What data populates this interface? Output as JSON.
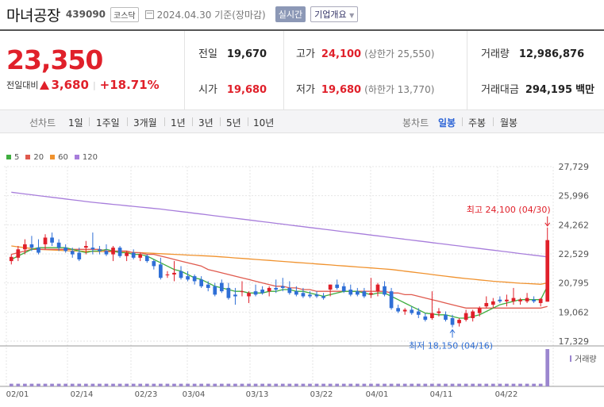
{
  "header": {
    "name": "마녀공장",
    "code": "439090",
    "market": "코스닥",
    "date_text": "2024.04.30 기준(장마감)",
    "live_button": "실시간",
    "company_button": "기업개요"
  },
  "summary": {
    "price": "23,350",
    "change_label": "전일대비",
    "change_value": "3,680",
    "change_pct": "+18.71%",
    "prev_label": "전일",
    "prev_value": "19,670",
    "high_label": "고가",
    "high_value": "24,100",
    "upper_limit": "(상한가 25,550)",
    "volume_label": "거래량",
    "volume_value": "12,986,876",
    "open_label": "시가",
    "open_value": "19,680",
    "low_label": "저가",
    "low_value": "19,680",
    "lower_limit": "(하한가 13,770)",
    "amount_label": "거래대금",
    "amount_value": "294,195",
    "amount_unit": "백만"
  },
  "periods": {
    "line_label": "선차트",
    "items": [
      "1일",
      "1주일",
      "3개월",
      "1년",
      "3년",
      "5년",
      "10년"
    ],
    "candle_label": "봉차트",
    "candle_items": [
      "일봉",
      "주봉",
      "월봉"
    ],
    "candle_active": "일봉"
  },
  "legend": [
    {
      "name": "5",
      "color": "#3fae3f"
    },
    {
      "name": "20",
      "color": "#e05a4e"
    },
    {
      "name": "60",
      "color": "#f0922e"
    },
    {
      "name": "120",
      "color": "#a77ddb"
    }
  ],
  "colors": {
    "up": "#e0202a",
    "down": "#2f6fd6",
    "volume": "#9b86cf"
  },
  "chart_data": {
    "type": "candlestick",
    "y_ticks": [
      "27,729",
      "25,996",
      "24,262",
      "22,529",
      "20,795",
      "19,062",
      "17,329"
    ],
    "ylim": [
      17329,
      27729
    ],
    "x_labels": [
      "02/01",
      "02/14",
      "02/23",
      "03/04",
      "03/13",
      "03/22",
      "04/01",
      "04/11",
      "04/22"
    ],
    "high_annotation": "최고 24,100 (04/30)",
    "low_annotation": "최저 18,150 (04/16)",
    "volume_label": "거래량",
    "candles": [
      {
        "o": 22100,
        "h": 22500,
        "l": 21900,
        "c": 22350
      },
      {
        "o": 22300,
        "h": 23000,
        "l": 22100,
        "c": 22800
      },
      {
        "o": 22800,
        "h": 23400,
        "l": 22500,
        "c": 23100
      },
      {
        "o": 23100,
        "h": 23600,
        "l": 22700,
        "c": 22900
      },
      {
        "o": 22900,
        "h": 23400,
        "l": 22500,
        "c": 22600
      },
      {
        "o": 23100,
        "h": 23700,
        "l": 22800,
        "c": 23500
      },
      {
        "o": 23500,
        "h": 23800,
        "l": 23000,
        "c": 23200
      },
      {
        "o": 23200,
        "h": 23400,
        "l": 22700,
        "c": 22900
      },
      {
        "o": 22900,
        "h": 23100,
        "l": 22600,
        "c": 22700
      },
      {
        "o": 22700,
        "h": 22900,
        "l": 22300,
        "c": 22500
      },
      {
        "o": 22600,
        "h": 22900,
        "l": 22100,
        "c": 22200
      },
      {
        "o": 22900,
        "h": 23300,
        "l": 22500,
        "c": 23000
      },
      {
        "o": 22900,
        "h": 23800,
        "l": 22500,
        "c": 22800
      },
      {
        "o": 22800,
        "h": 23000,
        "l": 22500,
        "c": 22700
      },
      {
        "o": 22700,
        "h": 23100,
        "l": 22400,
        "c": 22500
      },
      {
        "o": 22500,
        "h": 23000,
        "l": 22100,
        "c": 22900
      },
      {
        "o": 22900,
        "h": 23000,
        "l": 22300,
        "c": 22400
      },
      {
        "o": 22400,
        "h": 22700,
        "l": 22100,
        "c": 22600
      },
      {
        "o": 22600,
        "h": 22800,
        "l": 22200,
        "c": 22300
      },
      {
        "o": 22300,
        "h": 22600,
        "l": 22100,
        "c": 22500
      },
      {
        "o": 22400,
        "h": 22500,
        "l": 22000,
        "c": 22100
      },
      {
        "o": 22100,
        "h": 22200,
        "l": 21600,
        "c": 21800
      },
      {
        "o": 21900,
        "h": 22300,
        "l": 21000,
        "c": 21100
      },
      {
        "o": 21300,
        "h": 21500,
        "l": 21100,
        "c": 21300
      },
      {
        "o": 21300,
        "h": 22100,
        "l": 20900,
        "c": 21400
      },
      {
        "o": 21500,
        "h": 21800,
        "l": 21000,
        "c": 21100
      },
      {
        "o": 21200,
        "h": 21500,
        "l": 20900,
        "c": 21000
      },
      {
        "o": 21200,
        "h": 21300,
        "l": 20700,
        "c": 20900
      },
      {
        "o": 21000,
        "h": 21200,
        "l": 20500,
        "c": 20600
      },
      {
        "o": 20700,
        "h": 20900,
        "l": 20300,
        "c": 20500
      },
      {
        "o": 20600,
        "h": 20800,
        "l": 20000,
        "c": 20100
      },
      {
        "o": 20800,
        "h": 21000,
        "l": 20200,
        "c": 20300
      },
      {
        "o": 20500,
        "h": 20800,
        "l": 19800,
        "c": 19900
      },
      {
        "o": 20100,
        "h": 20500,
        "l": 19500,
        "c": 20000
      },
      {
        "o": 20300,
        "h": 20900,
        "l": 20000,
        "c": 20300
      },
      {
        "o": 20000,
        "h": 20300,
        "l": 19600,
        "c": 20200
      },
      {
        "o": 20300,
        "h": 20700,
        "l": 20000,
        "c": 20100
      },
      {
        "o": 20400,
        "h": 20600,
        "l": 20100,
        "c": 20200
      },
      {
        "o": 20300,
        "h": 20600,
        "l": 20000,
        "c": 20500
      },
      {
        "o": 20500,
        "h": 21000,
        "l": 20200,
        "c": 20400
      },
      {
        "o": 20600,
        "h": 21100,
        "l": 20300,
        "c": 20500
      },
      {
        "o": 20500,
        "h": 20900,
        "l": 20100,
        "c": 20200
      },
      {
        "o": 20300,
        "h": 20600,
        "l": 20000,
        "c": 20100
      },
      {
        "o": 20200,
        "h": 20500,
        "l": 19900,
        "c": 20000
      },
      {
        "o": 20100,
        "h": 20300,
        "l": 19900,
        "c": 20000
      },
      {
        "o": 20100,
        "h": 20300,
        "l": 19900,
        "c": 20000
      },
      {
        "o": 20000,
        "h": 20200,
        "l": 19800,
        "c": 19900
      },
      {
        "o": 20400,
        "h": 20700,
        "l": 20000,
        "c": 20700
      },
      {
        "o": 20700,
        "h": 21000,
        "l": 20400,
        "c": 20500
      },
      {
        "o": 20600,
        "h": 20800,
        "l": 20200,
        "c": 20300
      },
      {
        "o": 20400,
        "h": 20700,
        "l": 20000,
        "c": 20100
      },
      {
        "o": 20300,
        "h": 20500,
        "l": 20000,
        "c": 20100
      },
      {
        "o": 20300,
        "h": 20500,
        "l": 19900,
        "c": 20000
      },
      {
        "o": 20100,
        "h": 21100,
        "l": 19900,
        "c": 20200
      },
      {
        "o": 20300,
        "h": 20800,
        "l": 20000,
        "c": 20700
      },
      {
        "o": 20600,
        "h": 20900,
        "l": 20000,
        "c": 20100
      },
      {
        "o": 20300,
        "h": 20500,
        "l": 19200,
        "c": 19300
      },
      {
        "o": 19300,
        "h": 19500,
        "l": 19000,
        "c": 19100
      },
      {
        "o": 19100,
        "h": 19300,
        "l": 18900,
        "c": 19200
      },
      {
        "o": 19200,
        "h": 19400,
        "l": 18900,
        "c": 19000
      },
      {
        "o": 19100,
        "h": 19300,
        "l": 18700,
        "c": 18900
      },
      {
        "o": 18800,
        "h": 19000,
        "l": 18500,
        "c": 18600
      },
      {
        "o": 18700,
        "h": 20300,
        "l": 18600,
        "c": 19000
      },
      {
        "o": 19000,
        "h": 19300,
        "l": 18800,
        "c": 19100
      },
      {
        "o": 18900,
        "h": 19100,
        "l": 18500,
        "c": 18600
      },
      {
        "o": 18700,
        "h": 18900,
        "l": 18150,
        "c": 18300
      },
      {
        "o": 18400,
        "h": 18700,
        "l": 18200,
        "c": 18600
      },
      {
        "o": 18600,
        "h": 19200,
        "l": 18500,
        "c": 19000
      },
      {
        "o": 18700,
        "h": 19200,
        "l": 18500,
        "c": 19100
      },
      {
        "o": 19000,
        "h": 19400,
        "l": 18800,
        "c": 19300
      },
      {
        "o": 19400,
        "h": 20000,
        "l": 19300,
        "c": 19600
      },
      {
        "o": 19500,
        "h": 19900,
        "l": 19300,
        "c": 19700
      },
      {
        "o": 19800,
        "h": 20000,
        "l": 19600,
        "c": 19700
      },
      {
        "o": 19700,
        "h": 20100,
        "l": 19400,
        "c": 19800
      },
      {
        "o": 19700,
        "h": 20500,
        "l": 19500,
        "c": 19900
      },
      {
        "o": 19700,
        "h": 19900,
        "l": 19500,
        "c": 19800
      },
      {
        "o": 19700,
        "h": 20200,
        "l": 19600,
        "c": 19900
      },
      {
        "o": 19800,
        "h": 20000,
        "l": 19600,
        "c": 19700
      },
      {
        "o": 19600,
        "h": 19900,
        "l": 19400,
        "c": 19850
      },
      {
        "o": 19680,
        "h": 24100,
        "l": 19680,
        "c": 23350
      }
    ],
    "ma5": [
      22200,
      22400,
      22600,
      22800,
      22900,
      22900,
      22900,
      22900,
      22900,
      22800,
      22700,
      22600,
      22700,
      22700,
      22800,
      22700,
      22600,
      22600,
      22500,
      22500,
      22400,
      22200,
      22000,
      21800,
      21600,
      21500,
      21300,
      21100,
      21000,
      20800,
      20600,
      20500,
      20400,
      20300,
      20300,
      20200,
      20200,
      20200,
      20300,
      20300,
      20400,
      20400,
      20300,
      20300,
      20200,
      20100,
      20000,
      20100,
      20200,
      20300,
      20300,
      20300,
      20200,
      20100,
      20200,
      20200,
      20000,
      19800,
      19600,
      19400,
      19200,
      19000,
      18950,
      18900,
      18900,
      18800,
      18700,
      18700,
      18800,
      18900,
      19100,
      19300,
      19500,
      19600,
      19700,
      19800,
      19800,
      19800,
      19800,
      20600
    ],
    "ma20": [
      22500,
      22600,
      22700,
      22800,
      22800,
      22800,
      22800,
      22800,
      22800,
      22800,
      22800,
      22800,
      22800,
      22800,
      22700,
      22700,
      22700,
      22700,
      22600,
      22600,
      22500,
      22500,
      22400,
      22300,
      22200,
      22100,
      22000,
      21900,
      21800,
      21600,
      21500,
      21400,
      21300,
      21200,
      21100,
      21000,
      20900,
      20800,
      20700,
      20600,
      20600,
      20500,
      20500,
      20400,
      20400,
      20300,
      20300,
      20300,
      20300,
      20300,
      20300,
      20300,
      20300,
      20300,
      20300,
      20300,
      20200,
      20200,
      20100,
      20100,
      20000,
      19900,
      19800,
      19700,
      19600,
      19500,
      19400,
      19300,
      19300,
      19300,
      19300,
      19300,
      19300,
      19300,
      19300,
      19300,
      19300,
      19300,
      19300,
      19400
    ],
    "ma60": [
      23000,
      22950,
      22900,
      22850,
      22800,
      22780,
      22760,
      22740,
      22720,
      22700,
      22700,
      22690,
      22680,
      22670,
      22660,
      22650,
      22640,
      22630,
      22620,
      22600,
      22580,
      22560,
      22540,
      22520,
      22500,
      22480,
      22460,
      22440,
      22420,
      22400,
      22380,
      22350,
      22320,
      22290,
      22260,
      22230,
      22200,
      22170,
      22140,
      22110,
      22080,
      22050,
      22020,
      21990,
      21960,
      21930,
      21900,
      21870,
      21840,
      21810,
      21780,
      21750,
      21720,
      21690,
      21660,
      21630,
      21600,
      21550,
      21500,
      21450,
      21400,
      21350,
      21300,
      21250,
      21200,
      21150,
      21100,
      21060,
      21020,
      20980,
      20940,
      20900,
      20870,
      20840,
      20810,
      20780,
      20760,
      20740,
      20720,
      20800
    ],
    "ma120": [
      26200,
      26150,
      26100,
      26050,
      26000,
      25950,
      25900,
      25850,
      25800,
      25750,
      25700,
      25650,
      25600,
      25560,
      25520,
      25480,
      25440,
      25400,
      25360,
      25320,
      25280,
      25240,
      25200,
      25150,
      25100,
      25050,
      25000,
      24950,
      24900,
      24850,
      24800,
      24750,
      24700,
      24650,
      24600,
      24550,
      24500,
      24450,
      24400,
      24350,
      24300,
      24250,
      24200,
      24150,
      24100,
      24050,
      24000,
      23950,
      23900,
      23850,
      23800,
      23750,
      23700,
      23650,
      23600,
      23550,
      23500,
      23450,
      23400,
      23350,
      23300,
      23250,
      23200,
      23150,
      23100,
      23050,
      23000,
      22950,
      22900,
      22850,
      22800,
      22750,
      22700,
      22650,
      22600,
      22550,
      22500,
      22450,
      22400,
      22350
    ],
    "volume": [
      1,
      1,
      1,
      1,
      1,
      1,
      1,
      1,
      1,
      1,
      1,
      1,
      1,
      1,
      1,
      1,
      1,
      1,
      1,
      1,
      1,
      1,
      1,
      1,
      1,
      1,
      1,
      1,
      1,
      1,
      1,
      1,
      1,
      1,
      1,
      1,
      1,
      1,
      1,
      1,
      1,
      1,
      1,
      1,
      1,
      1,
      1,
      1,
      1,
      1,
      1,
      1,
      1,
      1,
      1,
      1,
      1,
      1,
      1,
      1,
      1,
      1,
      1,
      1,
      1,
      1,
      1,
      1,
      1,
      1,
      1,
      1,
      1,
      1,
      1,
      1,
      1,
      1,
      1,
      14
    ]
  }
}
